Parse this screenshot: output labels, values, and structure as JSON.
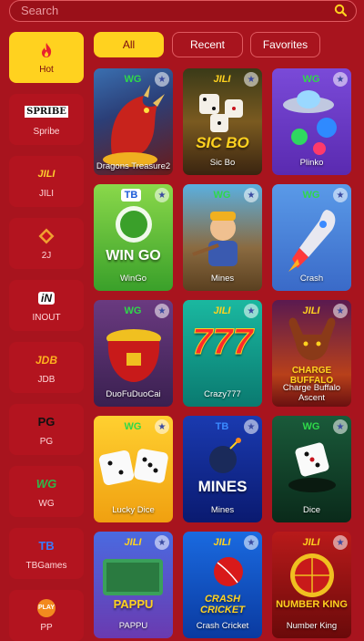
{
  "search": {
    "placeholder": "Search"
  },
  "sidebar": {
    "items": [
      {
        "label": "Hot",
        "icon": "fire-icon",
        "active": true
      },
      {
        "label": "Spribe",
        "icon": "spribe-logo",
        "logo_text": "SPRIBE"
      },
      {
        "label": "JILI",
        "icon": "jili-logo",
        "logo_text": "JILI"
      },
      {
        "label": "2J",
        "icon": "2j-logo"
      },
      {
        "label": "INOUT",
        "icon": "inout-logo",
        "logo_text": "iN"
      },
      {
        "label": "JDB",
        "icon": "jdb-logo",
        "logo_text": "JDB"
      },
      {
        "label": "PG",
        "icon": "pg-logo",
        "logo_text": "PG"
      },
      {
        "label": "WG",
        "icon": "wg-logo",
        "logo_text": "WG"
      },
      {
        "label": "TBGames",
        "icon": "tb-logo",
        "logo_text": "TB"
      },
      {
        "label": "PP",
        "icon": "pp-logo",
        "logo_text": "PLAY"
      }
    ]
  },
  "filters": [
    {
      "label": "All",
      "active": true
    },
    {
      "label": "Recent",
      "active": false
    },
    {
      "label": "Favorites",
      "active": false
    }
  ],
  "games": [
    {
      "name": "Dragons Treasure2",
      "brand": "WG"
    },
    {
      "name": "Sic Bo",
      "brand": "JILI",
      "art_text": "SIC BO"
    },
    {
      "name": "Plinko",
      "brand": "WG"
    },
    {
      "name": "WinGo",
      "brand": "TB",
      "art_text": "WIN GO"
    },
    {
      "name": "Mines",
      "brand": "WG"
    },
    {
      "name": "Crash",
      "brand": "WG"
    },
    {
      "name": "DuoFuDuoCai",
      "brand": "WG"
    },
    {
      "name": "Crazy777",
      "brand": "JILI",
      "art_text": "777"
    },
    {
      "name": "Charge Buffalo Ascent",
      "brand": "JILI",
      "art_text": "CHARGE BUFFALO"
    },
    {
      "name": "Lucky Dice",
      "brand": "WG"
    },
    {
      "name": "Mines",
      "brand": "TB",
      "art_text": "MINES"
    },
    {
      "name": "Dice",
      "brand": "WG"
    },
    {
      "name": "PAPPU",
      "brand": "JILI",
      "art_text": "PAPPU"
    },
    {
      "name": "Crash Cricket",
      "brand": "JILI",
      "art_text": "CRASH CRICKET"
    },
    {
      "name": "Number King",
      "brand": "JILI",
      "art_text": "NUMBER KING"
    }
  ],
  "colors": {
    "background": "#a8141e",
    "accent": "#ffd21f",
    "outline": "#e05a60"
  }
}
